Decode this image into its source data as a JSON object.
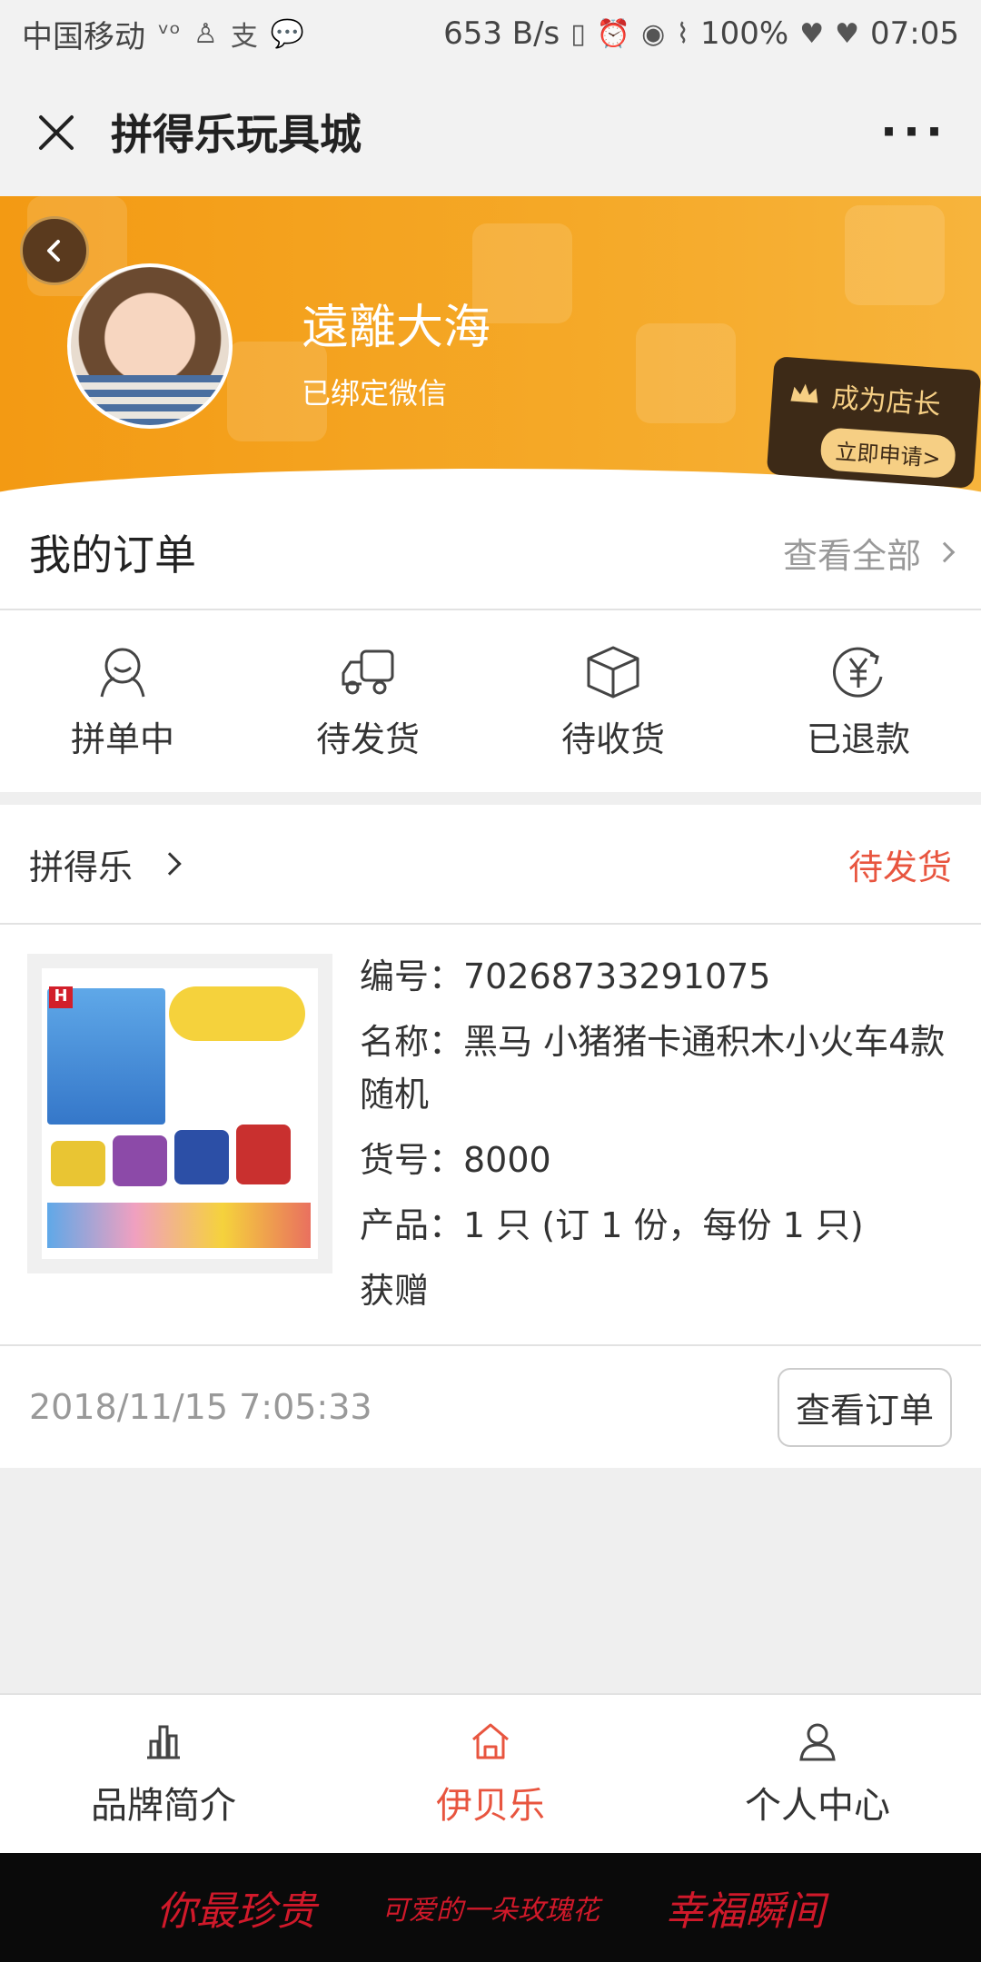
{
  "statusbar": {
    "carrier": "中国移动",
    "speed": "653 B/s",
    "battery": "100%",
    "time": "07:05"
  },
  "titlebar": {
    "title": "拼得乐玩具城",
    "more": "···"
  },
  "profile": {
    "name": "遠離大海",
    "bind_status": "已绑定微信",
    "shop_badge": "成为店长",
    "shop_apply": "立即申请>"
  },
  "orders": {
    "title": "我的订单",
    "view_all": "查看全部",
    "statuses": [
      {
        "label": "拼单中",
        "icon": "group-buy-icon"
      },
      {
        "label": "待发货",
        "icon": "truck-icon"
      },
      {
        "label": "待收货",
        "icon": "package-icon"
      },
      {
        "label": "已退款",
        "icon": "yuan-refund-icon"
      }
    ]
  },
  "order_card": {
    "store": "拼得乐",
    "status": "待发货",
    "product": {
      "id_line": "编号：70268733291075",
      "name_line": "名称：黑马 小猪猪卡通积木小火车4款随机",
      "sku_line": "货号：8000",
      "qty_line": "产品：1 只 (订 1 份，每份 1 只)",
      "gift_line": "获赠"
    },
    "datetime": "2018/11/15 7:05:33",
    "view_order_button": "查看订单"
  },
  "tabbar": {
    "items": [
      {
        "label": "品牌简介",
        "icon": "brand-chart-icon"
      },
      {
        "label": "伊贝乐",
        "icon": "home-icon",
        "active": true
      },
      {
        "label": "个人中心",
        "icon": "person-icon"
      }
    ]
  },
  "footer": {
    "deco_1": "你最珍贵",
    "deco_2": "可爱的一朵玫瑰花",
    "deco_3": "幸福瞬间"
  },
  "colors": {
    "brand_orange": "#f39a13",
    "accent_red": "#e8553f"
  }
}
